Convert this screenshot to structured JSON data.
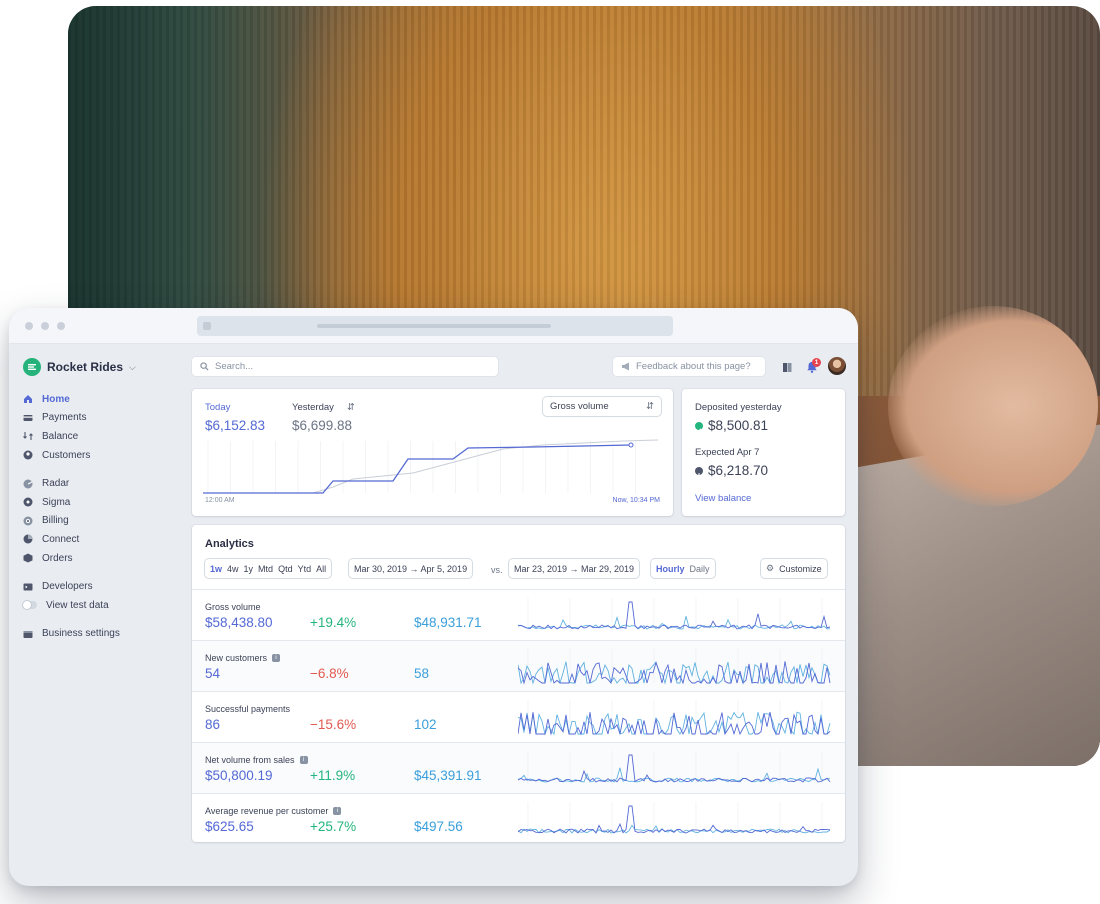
{
  "sidebar": {
    "brand": "Rocket Rides",
    "items": [
      {
        "label": "Home",
        "icon": "home-icon",
        "active": true
      },
      {
        "label": "Payments",
        "icon": "payments-icon"
      },
      {
        "label": "Balance",
        "icon": "balance-icon"
      },
      {
        "label": "Customers",
        "icon": "customers-icon"
      },
      {
        "label": "Radar",
        "icon": "radar-icon"
      },
      {
        "label": "Sigma",
        "icon": "sigma-icon"
      },
      {
        "label": "Billing",
        "icon": "billing-icon"
      },
      {
        "label": "Connect",
        "icon": "connect-icon"
      },
      {
        "label": "Orders",
        "icon": "orders-icon"
      },
      {
        "label": "Developers",
        "icon": "developers-icon"
      },
      {
        "label": "View test data",
        "icon": "toggle-icon"
      },
      {
        "label": "Business settings",
        "icon": "settings-icon"
      }
    ]
  },
  "header": {
    "search_placeholder": "Search...",
    "feedback": "Feedback about this page?",
    "notification_count": "1"
  },
  "today": {
    "today_label": "Today",
    "yesterday_label": "Yesterday",
    "today_value": "$6,152.83",
    "yesterday_value": "$6,699.88",
    "metric_select": "Gross volume",
    "axis_start": "12:00 AM",
    "axis_end": "Now, 10:34 PM"
  },
  "balance": {
    "deposited_label": "Deposited yesterday",
    "deposited_value": "$8,500.81",
    "expected_label": "Expected Apr 7",
    "expected_value": "$6,218.70",
    "view_balance": "View balance"
  },
  "analytics": {
    "title": "Analytics",
    "ranges": [
      "1w",
      "4w",
      "1y",
      "Mtd",
      "Qtd",
      "Ytd",
      "All"
    ],
    "active_range": "1w",
    "date_range": "Mar 30, 2019 →  Apr 5, 2019",
    "vs": "vs.",
    "compare_range": "Mar 23, 2019 → Mar 29, 2019",
    "granularity": [
      "Hourly",
      "Daily"
    ],
    "active_granularity": "Hourly",
    "customize": "Customize",
    "metrics": [
      {
        "name": "Gross volume",
        "value": "$58,438.80",
        "change": "+19.4%",
        "previous": "$48,931.71",
        "info": false,
        "positive": true
      },
      {
        "name": "New customers",
        "value": "54",
        "change": "−6.8%",
        "previous": "58",
        "info": true,
        "positive": false
      },
      {
        "name": "Successful payments",
        "value": "86",
        "change": "−15.6%",
        "previous": "102",
        "info": false,
        "positive": false
      },
      {
        "name": "Net volume from sales",
        "value": "$50,800.19",
        "change": "+11.9%",
        "previous": "$45,391.91",
        "info": true,
        "positive": true
      },
      {
        "name": "Average revenue per customer",
        "value": "$625.65",
        "change": "+25.7%",
        "previous": "$497.56",
        "info": true,
        "positive": true
      }
    ]
  },
  "colors": {
    "accent": "#5469d4",
    "previous": "#3a9fda",
    "positive": "#24b47e",
    "negative": "#e25950",
    "sidebar_text": "#3c4257"
  }
}
